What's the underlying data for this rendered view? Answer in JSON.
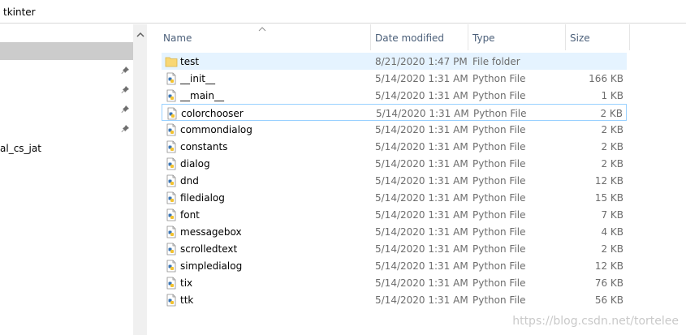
{
  "address": {
    "path": "tkinter"
  },
  "nav": {
    "label": "al_cs_jat"
  },
  "columns": {
    "name": "Name",
    "date": "Date modified",
    "type": "Type",
    "size": "Size"
  },
  "files": [
    {
      "name": "test",
      "date": "8/21/2020 1:47 PM",
      "type": "File folder",
      "size": "",
      "icon": "folder-icon"
    },
    {
      "name": "__init__",
      "date": "5/14/2020 1:31 AM",
      "type": "Python File",
      "size": "166 KB",
      "icon": "python-file-icon"
    },
    {
      "name": "__main__",
      "date": "5/14/2020 1:31 AM",
      "type": "Python File",
      "size": "1 KB",
      "icon": "python-file-icon"
    },
    {
      "name": "colorchooser",
      "date": "5/14/2020 1:31 AM",
      "type": "Python File",
      "size": "2 KB",
      "icon": "python-file-icon"
    },
    {
      "name": "commondialog",
      "date": "5/14/2020 1:31 AM",
      "type": "Python File",
      "size": "2 KB",
      "icon": "python-file-icon"
    },
    {
      "name": "constants",
      "date": "5/14/2020 1:31 AM",
      "type": "Python File",
      "size": "2 KB",
      "icon": "python-file-icon"
    },
    {
      "name": "dialog",
      "date": "5/14/2020 1:31 AM",
      "type": "Python File",
      "size": "2 KB",
      "icon": "python-file-icon"
    },
    {
      "name": "dnd",
      "date": "5/14/2020 1:31 AM",
      "type": "Python File",
      "size": "12 KB",
      "icon": "python-file-icon"
    },
    {
      "name": "filedialog",
      "date": "5/14/2020 1:31 AM",
      "type": "Python File",
      "size": "15 KB",
      "icon": "python-file-icon"
    },
    {
      "name": "font",
      "date": "5/14/2020 1:31 AM",
      "type": "Python File",
      "size": "7 KB",
      "icon": "python-file-icon"
    },
    {
      "name": "messagebox",
      "date": "5/14/2020 1:31 AM",
      "type": "Python File",
      "size": "4 KB",
      "icon": "python-file-icon"
    },
    {
      "name": "scrolledtext",
      "date": "5/14/2020 1:31 AM",
      "type": "Python File",
      "size": "2 KB",
      "icon": "python-file-icon"
    },
    {
      "name": "simpledialog",
      "date": "5/14/2020 1:31 AM",
      "type": "Python File",
      "size": "12 KB",
      "icon": "python-file-icon"
    },
    {
      "name": "tix",
      "date": "5/14/2020 1:31 AM",
      "type": "Python File",
      "size": "76 KB",
      "icon": "python-file-icon"
    },
    {
      "name": "ttk",
      "date": "5/14/2020 1:31 AM",
      "type": "Python File",
      "size": "56 KB",
      "icon": "python-file-icon"
    }
  ],
  "watermark": "https://blog.csdn.net/tortelee",
  "colors": {
    "selected_row": "#e5f3ff",
    "focus_border": "#99d1ff",
    "header_text": "#4c607a",
    "secondary_text": "#6d6d6d",
    "folder": "#f8d775"
  }
}
